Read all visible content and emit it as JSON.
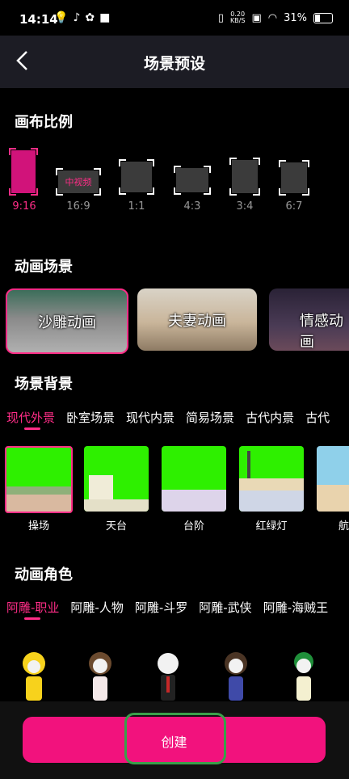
{
  "status": {
    "time": "14:14",
    "speed_top": "0.20",
    "speed_bottom": "KB/S",
    "battery": "31%"
  },
  "header": {
    "title": "场景预设"
  },
  "ratio_section": {
    "title": "画布比例",
    "selected": "9:16",
    "tag_16_9": "中视频",
    "items": [
      {
        "label": "9:16"
      },
      {
        "label": "16:9"
      },
      {
        "label": "1:1"
      },
      {
        "label": "4:3"
      },
      {
        "label": "3:4"
      },
      {
        "label": "6:7"
      }
    ]
  },
  "scene_section": {
    "title": "动画场景",
    "items": [
      {
        "label": "沙雕动画"
      },
      {
        "label": "夫妻动画"
      },
      {
        "label": "情感动画"
      }
    ]
  },
  "background_section": {
    "title": "场景背景",
    "tabs": [
      {
        "label": "现代外景"
      },
      {
        "label": "卧室场景"
      },
      {
        "label": "现代内景"
      },
      {
        "label": "简易场景"
      },
      {
        "label": "古代内景"
      },
      {
        "label": "古代"
      }
    ],
    "items": [
      {
        "label": "操场"
      },
      {
        "label": "天台"
      },
      {
        "label": "台阶"
      },
      {
        "label": "红绿灯"
      },
      {
        "label": "航"
      }
    ]
  },
  "character_section": {
    "title": "动画角色",
    "tabs": [
      {
        "label": "阿雕-职业"
      },
      {
        "label": "阿雕-人物"
      },
      {
        "label": "阿雕-斗罗"
      },
      {
        "label": "阿雕-武侠"
      },
      {
        "label": "阿雕-海贼王"
      }
    ]
  },
  "actions": {
    "create_label": "创建"
  },
  "colors": {
    "accent": "#ff2d87",
    "button": "#f2127d",
    "green_screen": "#2ef000"
  }
}
